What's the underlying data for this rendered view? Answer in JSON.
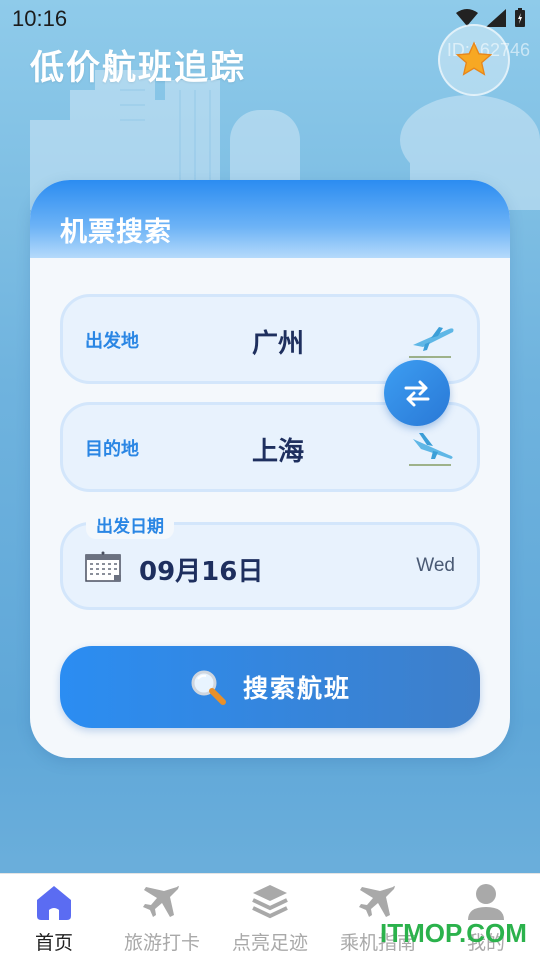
{
  "status_bar": {
    "time": "10:16"
  },
  "header": {
    "title": "低价航班追踪",
    "id_text": "ID:162746"
  },
  "card": {
    "title": "机票搜索",
    "departure": {
      "label": "出发地",
      "value": "广州"
    },
    "destination": {
      "label": "目的地",
      "value": "上海"
    },
    "date": {
      "label": "出发日期",
      "value": "09月16日",
      "weekday": "Wed"
    },
    "search_button": "搜索航班"
  },
  "bottom_nav": {
    "items": [
      {
        "label": "首页",
        "icon": "home-icon",
        "active": true
      },
      {
        "label": "旅游打卡",
        "icon": "plane-icon",
        "active": false
      },
      {
        "label": "点亮足迹",
        "icon": "layers-icon",
        "active": false
      },
      {
        "label": "乘机指南",
        "icon": "plane-icon",
        "active": false
      },
      {
        "label": "我的",
        "icon": "user-icon",
        "active": false
      }
    ]
  },
  "watermark": "ITMOP.COM",
  "colors": {
    "accent": "#2a86e4",
    "title_dark": "#1e2f5e",
    "nav_active": "#5b6cf2",
    "nav_inactive": "#a9a9a9"
  }
}
